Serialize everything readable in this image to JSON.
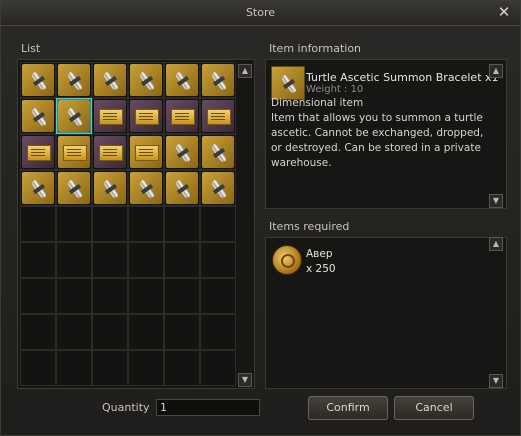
{
  "window": {
    "title": "Store"
  },
  "list": {
    "label": "List",
    "rows": [
      [
        "bracelet",
        "bracelet",
        "bracelet",
        "bracelet",
        "bracelet",
        "bracelet"
      ],
      [
        "bracelet",
        "bracelet-selected",
        "ticket-purple",
        "ticket-purple",
        "ticket-purple",
        "ticket-purple"
      ],
      [
        "ticket-purple",
        "ticket",
        "ticket-purple",
        "ticket",
        "bracelet",
        "bracelet"
      ],
      [
        "bracelet",
        "bracelet",
        "bracelet",
        "bracelet",
        "bracelet",
        "bracelet"
      ],
      [
        "",
        "",
        "",
        "",
        "",
        ""
      ],
      [
        "",
        "",
        "",
        "",
        "",
        ""
      ],
      [
        "",
        "",
        "",
        "",
        "",
        ""
      ],
      [
        "",
        "",
        "",
        "",
        "",
        ""
      ],
      [
        "",
        "",
        "",
        "",
        "",
        ""
      ]
    ]
  },
  "item_info": {
    "label": "Item information",
    "name": "Turtle Ascetic Summon Bracelet x1",
    "weight": "Weight : 10",
    "type": "Dimensional item",
    "description": "Item that allows you to summon a turtle ascetic. Cannot be exchanged, dropped, or destroyed. Can be stored in a private warehouse."
  },
  "required": {
    "label": "Items required",
    "name": "Авер",
    "quantity": "x 250"
  },
  "quantity": {
    "label": "Quantity",
    "value": "1"
  },
  "buttons": {
    "confirm": "Confirm",
    "cancel": "Cancel"
  },
  "icons": {
    "close": "close-icon",
    "scroll_up": "arrow-up-icon",
    "scroll_down": "arrow-down-icon"
  },
  "colors": {
    "selection": "#4bd0d0",
    "gold_item": "#caa038",
    "purple_item": "#6a4b63"
  }
}
